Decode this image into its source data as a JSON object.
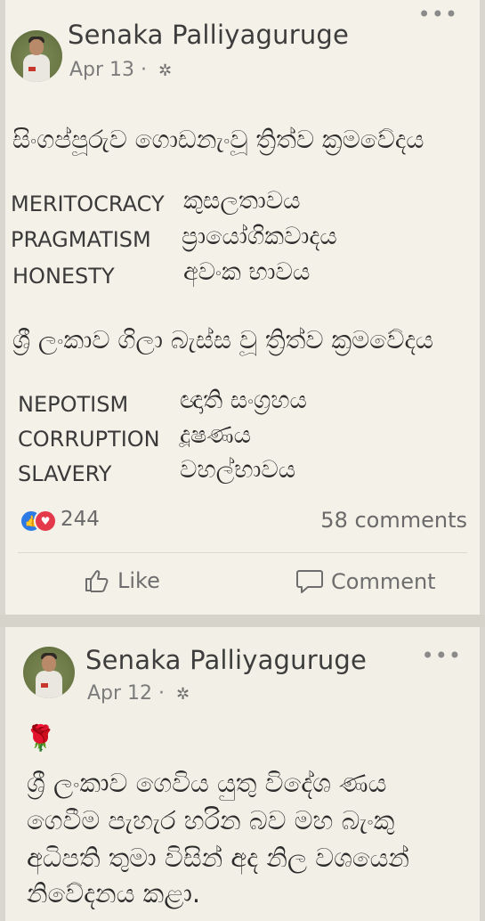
{
  "post1": {
    "author": "Senaka Palliyaguruge",
    "date": "Apr 13",
    "separator": "·",
    "more": "•••",
    "heading1": "සිංගප්පූරුව ගොඩනැංවූ ත්‍රිත්ව ක්‍රමවේදය",
    "terms1": [
      {
        "en": "MERITOCRACY",
        "si": "කුසලතාවය"
      },
      {
        "en": "PRAGMATISM",
        "si": "ප්‍රායෝගිකවාදය"
      },
      {
        "en": "HONESTY",
        "si": "අවංක භාවය"
      }
    ],
    "heading2": "ශ්‍රී ලංකාව ගිලා බැස්ස වූ ත්‍රිත්ව ක්‍රමවේදය",
    "terms2": [
      {
        "en": "NEPOTISM",
        "si": "ඥාති සංග්‍රහය"
      },
      {
        "en": "CORRUPTION",
        "si": "දූෂණය"
      },
      {
        "en": "SLAVERY",
        "si": "වහල්භාවය"
      }
    ],
    "reaction_count": "244",
    "comments": "58 comments",
    "like_label": "Like",
    "comment_label": "Comment"
  },
  "post2": {
    "author": "Senaka Palliyaguruge",
    "date": "Apr 12",
    "separator": "·",
    "more": "•••",
    "emoji": "🌹",
    "lines": [
      "ශ්‍රී ලංකාව ගෙවිය යුතු විදේශ ණය",
      "ගෙවීම පැහැර හරින බව මහ බැංකු",
      "අධිපති තුමා විසින් අද නිල වශයෙන්",
      "නිවේදනය කළා."
    ]
  },
  "colors": {
    "like_blue": "#2d7ae6",
    "love_red": "#e4394a",
    "background": "#f4f1e8"
  },
  "icons": {
    "audience": "gear-icon",
    "like": "thumbs-up-icon",
    "comment": "speech-bubble-icon"
  }
}
